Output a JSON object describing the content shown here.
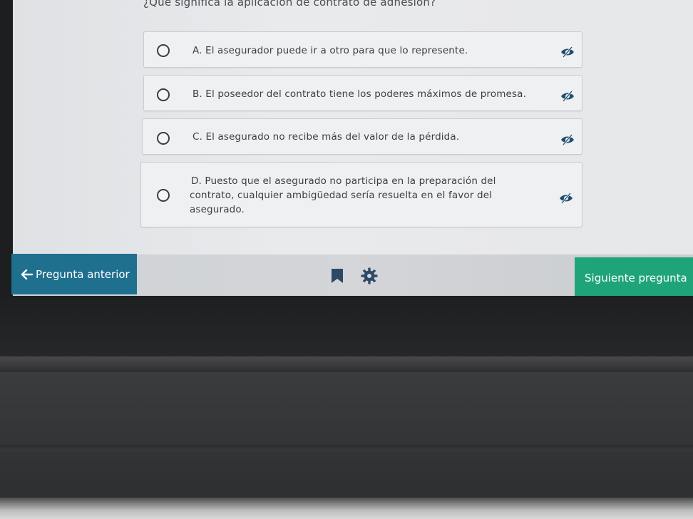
{
  "question": {
    "text": "¿Qué significa la aplicación de contrato de adhesión?"
  },
  "options": [
    {
      "line1": "A. El asegurador puede ir a otro para que lo represente.",
      "line2": "",
      "line3": ""
    },
    {
      "line1": "B. El poseedor del contrato tiene los poderes máximos de promesa.",
      "line2": "",
      "line3": ""
    },
    {
      "line1": "C. El asegurado no recibe más del valor de la pérdida.",
      "line2": "",
      "line3": ""
    },
    {
      "line1": "D. Puesto que el asegurado no participa en la preparación del",
      "line2": "contrato, cualquier ambigüedad sería resuelta en el favor del",
      "line3": "asegurado."
    }
  ],
  "toolbar": {
    "prev_label": "Pregunta anterior",
    "next_label": "Siguiente pregunta",
    "prev_icon": "arrow-left-icon",
    "bookmark_icon": "bookmark-icon",
    "settings_icon": "gear-icon",
    "hide_icon": "eye-slash-icon"
  },
  "colors": {
    "prev_button": "#1f6f8f",
    "next_button": "#1fa47a",
    "eye_icon": "#1f4e6e"
  }
}
